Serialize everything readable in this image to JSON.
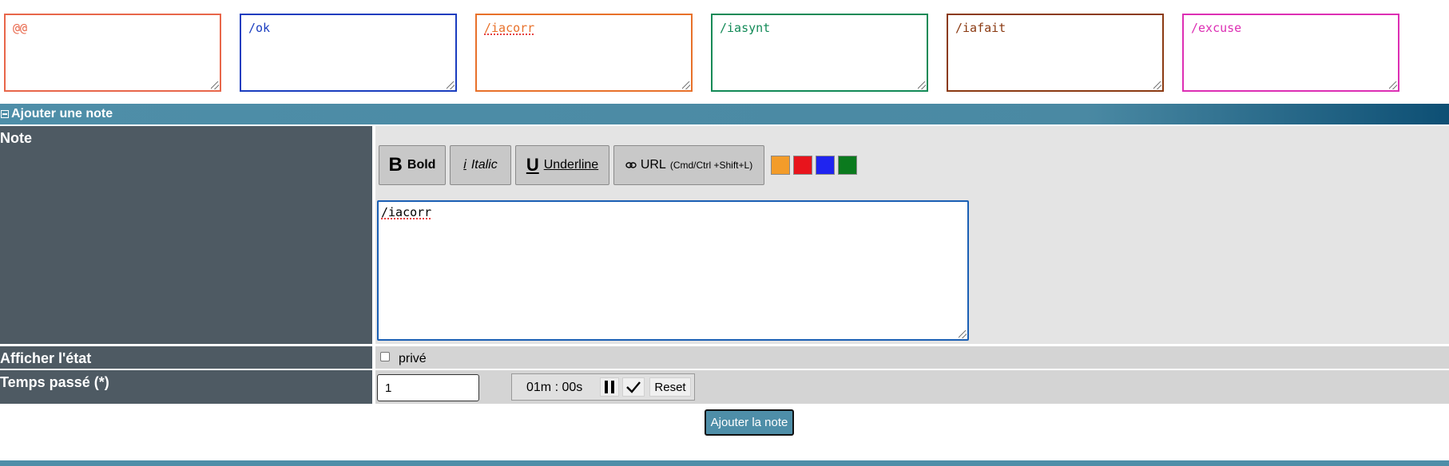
{
  "macros": [
    {
      "text": "@@",
      "color": "#e8664a"
    },
    {
      "text": "/ok",
      "color": "#1a3dbf"
    },
    {
      "text": "/iacorr",
      "color": "#e8712a"
    },
    {
      "text": "/iasynt",
      "color": "#128a57"
    },
    {
      "text": "/iafait",
      "color": "#8b3a12"
    },
    {
      "text": "/excuse",
      "color": "#dd2fb4"
    }
  ],
  "section": {
    "title": "Ajouter une note",
    "bar_color": "#4e8ea8"
  },
  "form": {
    "note_label": "Note",
    "state_label": "Afficher l'état",
    "time_label": "Temps passé (*)"
  },
  "toolbar": {
    "bold": {
      "icon": "B",
      "label": "Bold"
    },
    "italic": {
      "icon": "i",
      "label": "Italic"
    },
    "underline": {
      "icon": "U",
      "label": "Underline"
    },
    "url": {
      "icon": "link-icon",
      "label": "URL",
      "shortcut": "(Cmd/Ctrl +Shift+L)"
    },
    "colors": [
      "#f39c2a",
      "#e8141c",
      "#1f24f0",
      "#0b7a1e"
    ]
  },
  "editor": {
    "text": "/iacorr"
  },
  "private": {
    "label": "privé",
    "checked": false
  },
  "time": {
    "value": "1",
    "timer_display": "01m : 00s",
    "reset_label": "Reset"
  },
  "submit_label": "Ajouter la note"
}
